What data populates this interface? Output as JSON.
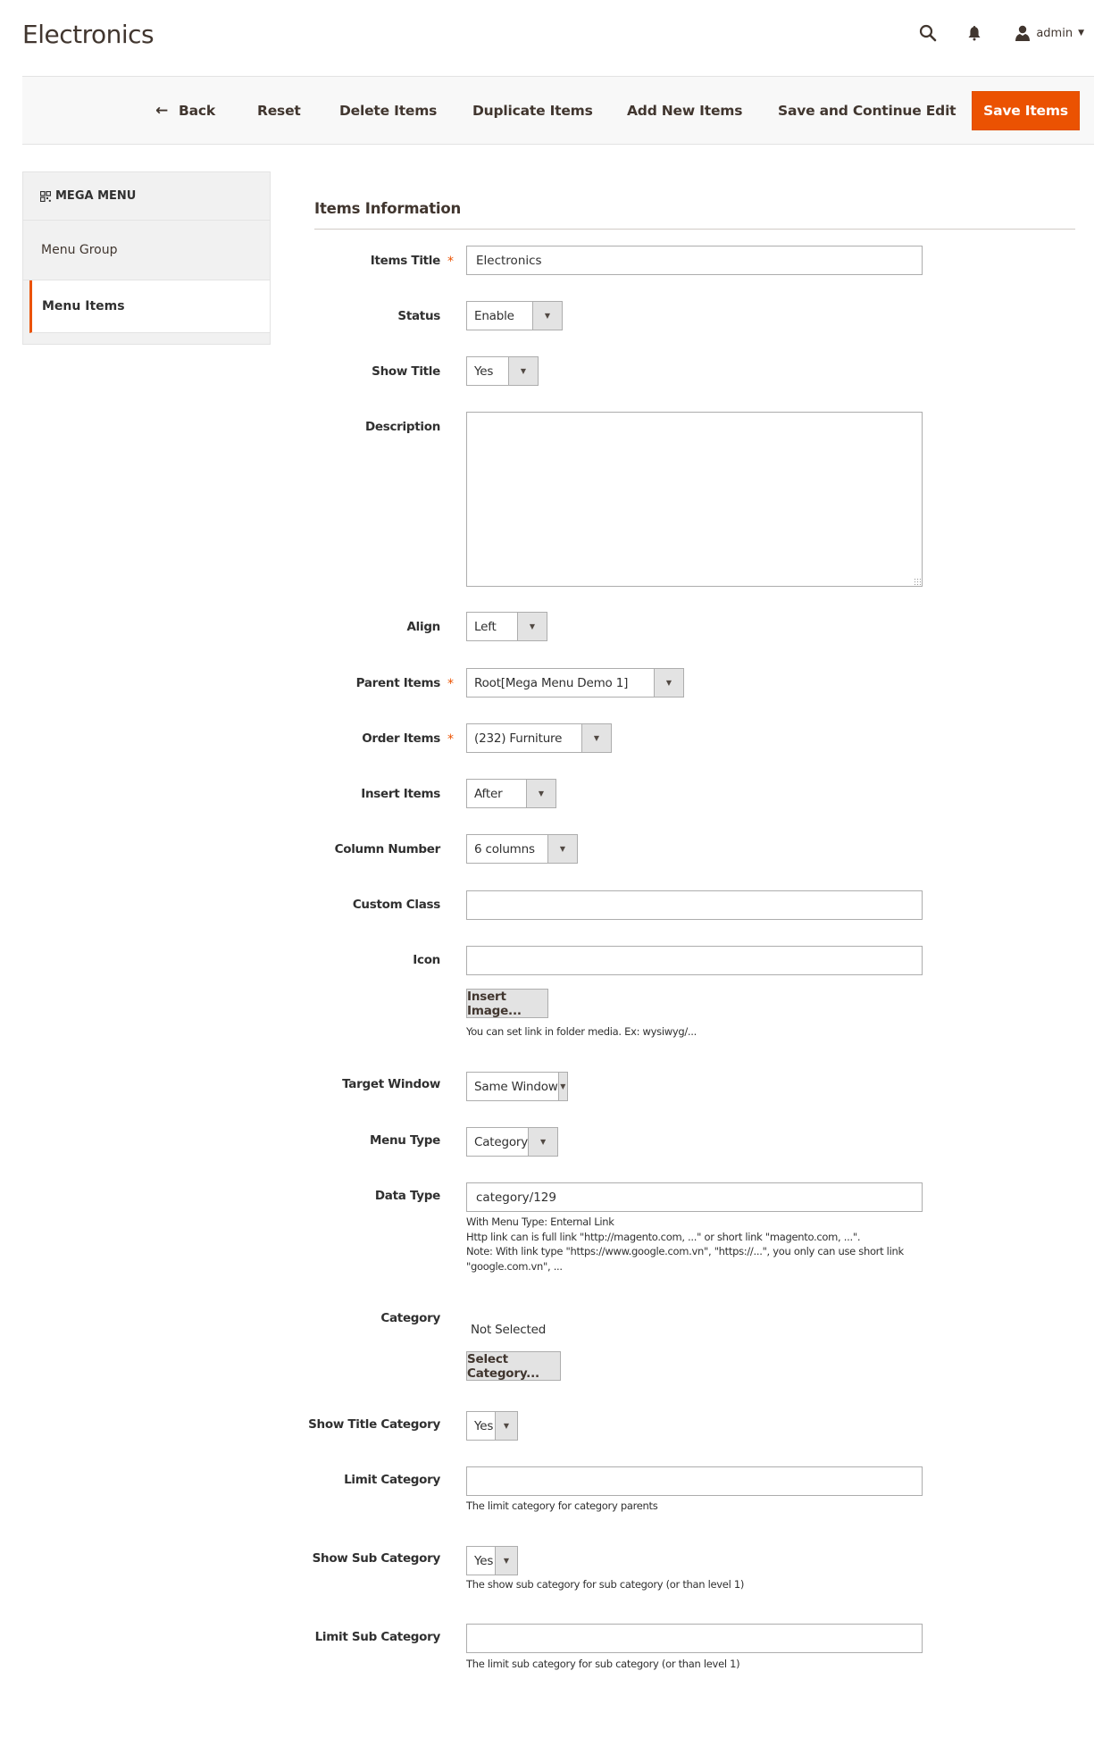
{
  "page": {
    "title": "Electronics"
  },
  "header": {
    "search_icon": "search-icon",
    "notifications_icon": "bell-icon",
    "user_icon": "user-icon",
    "username": "admin",
    "user_caret": "▼"
  },
  "toolbar": {
    "back_label": "Back",
    "back_icon": "←",
    "reset_label": "Reset",
    "delete_label": "Delete Items",
    "duplicate_label": "Duplicate Items",
    "add_new_label": "Add New Items",
    "save_continue_label": "Save and Continue Edit",
    "save_label": "Save Items",
    "accent_color": "#eb5202"
  },
  "sidebar": {
    "title": "MEGA MENU",
    "items": [
      {
        "label": "Menu Group",
        "active": false
      },
      {
        "label": "Menu Items",
        "active": true
      }
    ]
  },
  "form": {
    "section_title": "Items Information",
    "required_mark": "*",
    "dropdown_arrow": "▼",
    "fields": {
      "items_title": {
        "label": "Items Title",
        "value": "Electronics",
        "required": true
      },
      "status": {
        "label": "Status",
        "value": "Enable"
      },
      "show_title": {
        "label": "Show Title",
        "value": "Yes"
      },
      "description": {
        "label": "Description",
        "value": ""
      },
      "align": {
        "label": "Align",
        "value": "Left"
      },
      "parent_items": {
        "label": "Parent Items",
        "value": "Root[Mega Menu Demo 1]",
        "required": true
      },
      "order_items": {
        "label": "Order Items",
        "value": "(232) Furniture",
        "required": true
      },
      "insert_items": {
        "label": "Insert Items",
        "value": "After"
      },
      "column_number": {
        "label": "Column Number",
        "value": "6 columns"
      },
      "custom_class": {
        "label": "Custom Class",
        "value": ""
      },
      "icon": {
        "label": "Icon",
        "value": "",
        "button_label": "Insert Image...",
        "hint": "You can set link in folder media. Ex: wysiwyg/..."
      },
      "target_window": {
        "label": "Target Window",
        "value": "Same Window"
      },
      "menu_type": {
        "label": "Menu Type",
        "value": "Category"
      },
      "data_type": {
        "label": "Data Type",
        "value": "category/129",
        "notes": [
          "With Menu Type: Enternal Link",
          "Http link can is full link \"http://magento.com, ...\" or short link \"magento.com, ...\".",
          "Note: With link type \"https://www.google.com.vn\", \"https://...\", you only can use short link",
          "\"google.com.vn\", ..."
        ]
      },
      "category": {
        "label": "Category",
        "value": "Not Selected",
        "button_label": "Select Category..."
      },
      "show_title_category": {
        "label": "Show Title Category",
        "value": "Yes"
      },
      "limit_category": {
        "label": "Limit Category",
        "value": "",
        "hint": "The limit category for category parents"
      },
      "show_sub_category": {
        "label": "Show Sub Category",
        "value": "Yes",
        "hint": "The show sub category for sub category (or than level 1)"
      },
      "limit_sub_category": {
        "label": "Limit Sub Category",
        "value": "",
        "hint": "The limit sub category for sub category (or than level 1)"
      }
    }
  }
}
